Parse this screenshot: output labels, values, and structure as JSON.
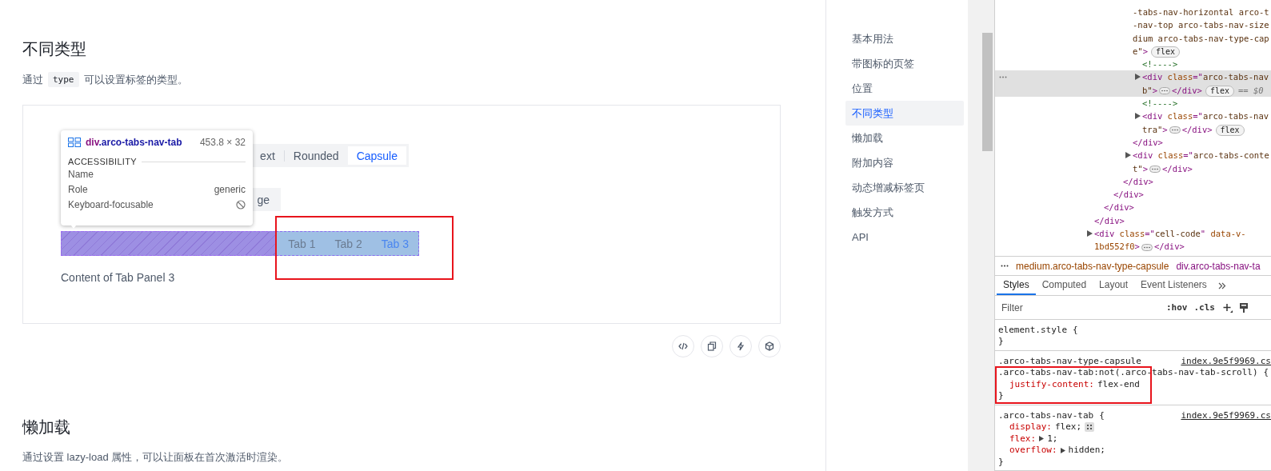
{
  "article": {
    "title": "不同类型",
    "description": {
      "before": "通过",
      "code": "type",
      "after": "可以设置标签的类型。"
    }
  },
  "demo": {
    "rows": [
      {
        "tabs": [
          {
            "label": "ext",
            "selected": false
          },
          {
            "label": "Rounded",
            "selected": false
          },
          {
            "label": "Capsule",
            "selected": true
          }
        ]
      },
      {
        "tabs": [
          {
            "label": "ge",
            "selected": false
          }
        ]
      }
    ],
    "inspected_tabs": [
      {
        "label": "Tab 1",
        "selected": false
      },
      {
        "label": "Tab 2",
        "selected": false
      },
      {
        "label": "Tab 3",
        "selected": true
      }
    ],
    "content": "Content of Tab Panel 3"
  },
  "tooltip": {
    "tag": "div",
    "selector": ".arco-tabs-nav-tab",
    "size": "453.8 × 32",
    "section": "ACCESSIBILITY",
    "properties": [
      {
        "name": "Name",
        "kind": "empty"
      },
      {
        "name": "Role",
        "kind": "text",
        "value": "generic"
      },
      {
        "name": "Keyboard-focusable",
        "kind": "blocked"
      }
    ]
  },
  "next_section": {
    "title": "懒加载",
    "description": "通过设置 lazy-load 属性，可以让面板在首次激活时渲染。"
  },
  "toc": [
    {
      "label": "基本用法",
      "selected": false
    },
    {
      "label": "带图标的页签",
      "selected": false
    },
    {
      "label": "位置",
      "selected": false
    },
    {
      "label": "不同类型",
      "selected": true
    },
    {
      "label": "懒加载",
      "selected": false
    },
    {
      "label": "附加内容",
      "selected": false
    },
    {
      "label": "动态增减标签页",
      "selected": false
    },
    {
      "label": "触发方式",
      "selected": false
    },
    {
      "label": "API",
      "selected": false
    }
  ],
  "devtools": {
    "elements": [
      {
        "close": "</div>",
        "children": [
          {
            "close": "</div>",
            "children": [
              {
                "close": "</div>",
                "children": [
                  {
                    "close": "</div>",
                    "children": [
                      {
                        "selected": false,
                        "badge": "flex",
                        "lines": [
                          [
                            {
                              "text": "-tabs-nav-horizontal arco-t",
                              "kind": "val"
                            }
                          ],
                          [
                            {
                              "text": "-nav-top arco-tabs-nav-size",
                              "kind": "val"
                            }
                          ],
                          [
                            {
                              "text": "dium arco-tabs-nav-type-cap",
                              "kind": "val"
                            }
                          ],
                          [
                            {
                              "text": "e\"",
                              "kind": "val"
                            },
                            {
                              "text": ">",
                              "kind": "tag"
                            }
                          ]
                        ],
                        "close": "</div>",
                        "children": [
                          {
                            "selected": false,
                            "lines": [
                              [
                                {
                                  "text": "<!---->",
                                  "kind": "comment"
                                }
                              ]
                            ]
                          },
                          {
                            "selected": true,
                            "expanded": false,
                            "badge": "flex",
                            "suffix": "== $0",
                            "lines": [
                              [
                                {
                                  "text": "<div ",
                                  "kind": "tag"
                                },
                                {
                                  "text": "class",
                                  "kind": "attr"
                                },
                                {
                                  "text": "=\"",
                                  "kind": "tag"
                                },
                                {
                                  "text": "arco-tabs-nav",
                                  "kind": "val"
                                }
                              ],
                              [
                                {
                                  "text": "b\"",
                                  "kind": "val"
                                },
                                {
                                  "text": ">",
                                  "kind": "tag"
                                }
                              ]
                            ],
                            "close": "</div>"
                          },
                          {
                            "selected": false,
                            "lines": [
                              [
                                {
                                  "text": "<!---->",
                                  "kind": "comment"
                                }
                              ]
                            ]
                          },
                          {
                            "selected": false,
                            "expanded": false,
                            "badge": "flex",
                            "lines": [
                              [
                                {
                                  "text": "<div ",
                                  "kind": "tag"
                                },
                                {
                                  "text": "class",
                                  "kind": "attr"
                                },
                                {
                                  "text": "=\"",
                                  "kind": "tag"
                                },
                                {
                                  "text": "arco-tabs-nav",
                                  "kind": "val"
                                }
                              ],
                              [
                                {
                                  "text": "tra\"",
                                  "kind": "val"
                                },
                                {
                                  "text": ">",
                                  "kind": "tag"
                                }
                              ]
                            ],
                            "close": "</div>"
                          }
                        ]
                      },
                      {
                        "selected": false,
                        "expanded": false,
                        "lines": [
                          [
                            {
                              "text": "<div ",
                              "kind": "tag"
                            },
                            {
                              "text": "class",
                              "kind": "attr"
                            },
                            {
                              "text": "=\"",
                              "kind": "tag"
                            },
                            {
                              "text": "arco-tabs-conte",
                              "kind": "val"
                            }
                          ],
                          [
                            {
                              "text": "t\"",
                              "kind": "val"
                            },
                            {
                              "text": ">",
                              "kind": "tag"
                            }
                          ]
                        ],
                        "close": "</div>"
                      }
                    ]
                  }
                ]
              }
            ]
          }
        ]
      },
      {
        "selected": false,
        "expanded": false,
        "lines": [
          [
            {
              "text": "<div ",
              "kind": "tag"
            },
            {
              "text": "class",
              "kind": "attr"
            },
            {
              "text": "=\"",
              "kind": "tag"
            },
            {
              "text": "cell-code",
              "kind": "val"
            },
            {
              "text": "\" ",
              "kind": "tag"
            },
            {
              "text": "data-v-",
              "kind": "attr"
            }
          ],
          [
            {
              "text": "1bd552f0",
              "kind": "attr"
            },
            {
              "text": ">",
              "kind": "tag"
            }
          ]
        ],
        "close": "</div>"
      }
    ],
    "breadcrumb": [
      {
        "text": "medium.arco-tabs-nav-type-capsule",
        "kind": "class"
      },
      {
        "text": "div.arco-tabs-nav-ta",
        "kind": "element"
      }
    ],
    "tabs": [
      {
        "label": "Styles",
        "selected": true
      },
      {
        "label": "Computed",
        "selected": false
      },
      {
        "label": "Layout",
        "selected": false
      },
      {
        "label": "Event Listeners",
        "selected": false
      }
    ],
    "filter": {
      "placeholder": "Filter"
    },
    "toggles": [
      ":hov",
      ".cls"
    ],
    "rules": [
      {
        "selectors": [
          "element.style"
        ],
        "open": "{",
        "close": "}",
        "highlighted": false
      },
      {
        "selectors": [
          ".arco-tabs-nav-type-capsule",
          ".arco-tabs-nav-tab:not(.arco-tabs-nav-tab-scroll)"
        ],
        "open": "{",
        "source": "index.9e5f9969.cs",
        "close": "}",
        "highlighted": true,
        "declarations": [
          {
            "property": "justify-content:",
            "value": "flex-end",
            "kind": "plain"
          }
        ]
      },
      {
        "selectors": [
          ".arco-tabs-nav-tab"
        ],
        "open": "{",
        "source": "index.9e5f9969.cs",
        "close": "}",
        "highlighted": false,
        "declarations": [
          {
            "property": "display:",
            "value": "flex;",
            "kind": "grid"
          },
          {
            "property": "flex:",
            "value": "1;",
            "kind": "shorthand"
          },
          {
            "property": "overflow:",
            "value": "hidden;",
            "kind": "shorthand"
          }
        ]
      }
    ]
  }
}
